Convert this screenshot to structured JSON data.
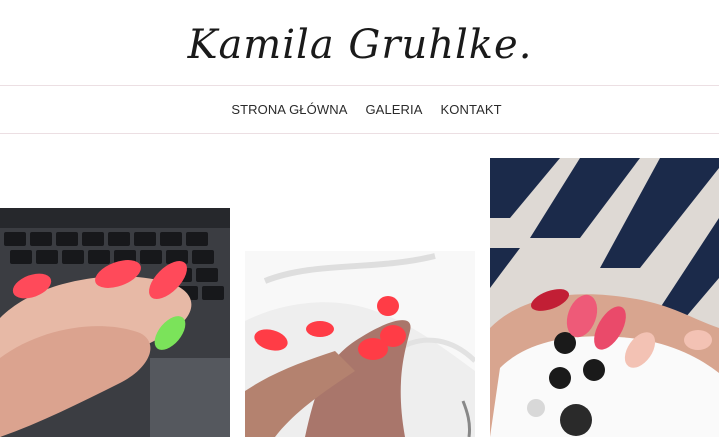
{
  "brand": {
    "name": "Kamila Gruhlke."
  },
  "nav": {
    "items": [
      {
        "label": "STRONA GŁÓWNA"
      },
      {
        "label": "GALERIA"
      },
      {
        "label": "KONTAKT"
      }
    ]
  },
  "gallery": {
    "photos": [
      {
        "subject": "coral and green almond nails on laptop keyboard"
      },
      {
        "subject": "neon coral nails on white fabric"
      },
      {
        "subject": "pink and nude nails holding white game controller"
      }
    ]
  },
  "colors": {
    "nav_text": "#2b2b2b",
    "divider": "#ecdfe3",
    "nail_coral": "#ff4a5a",
    "nail_green": "#7be35a",
    "nail_pink": "#ee5a78",
    "nail_nude": "#f3c2b4"
  }
}
